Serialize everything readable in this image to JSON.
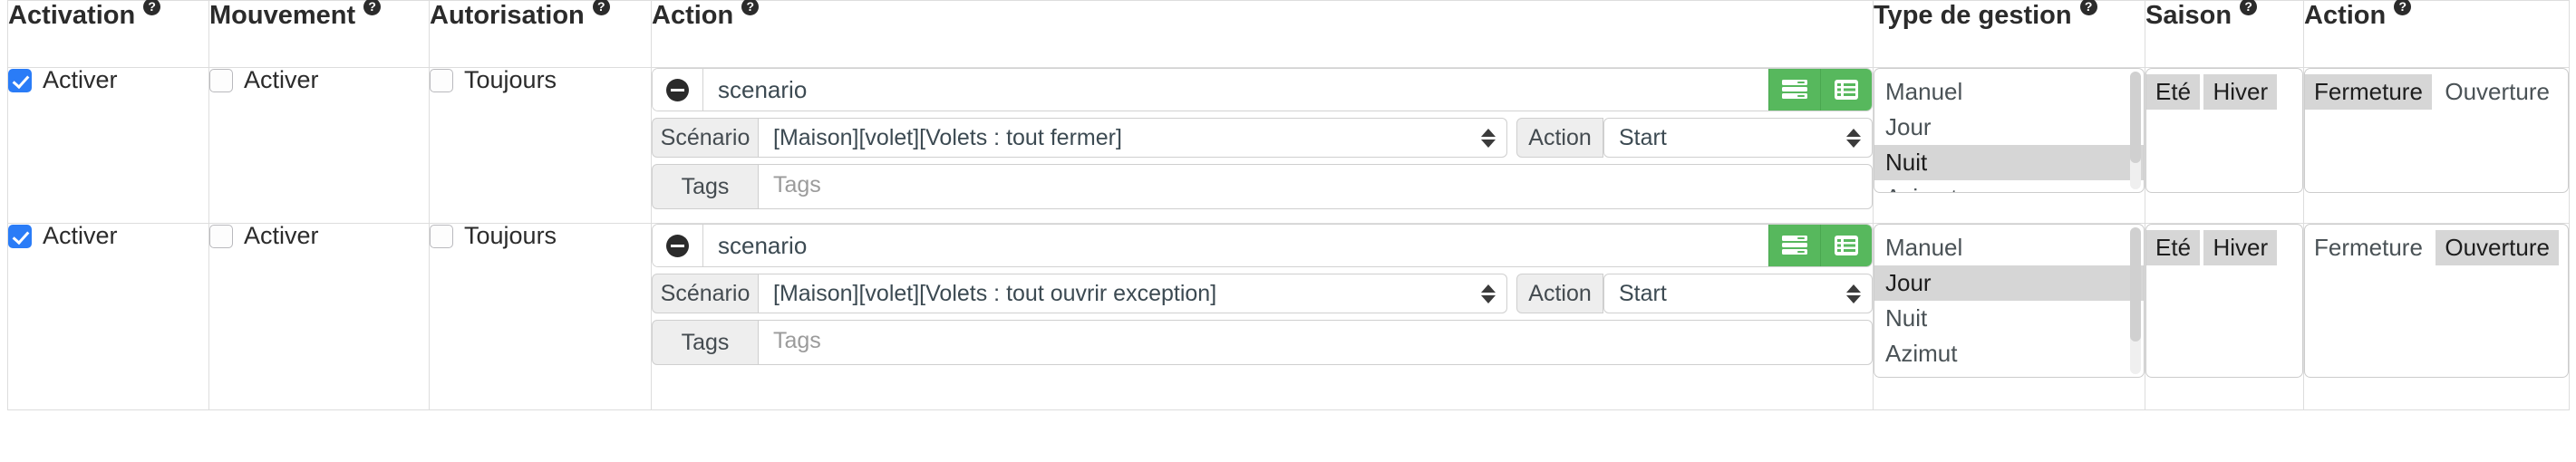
{
  "table": {
    "headers": [
      {
        "label": "Activation",
        "help": "?"
      },
      {
        "label": "Mouvement",
        "help": "?"
      },
      {
        "label": "Autorisation",
        "help": "?"
      },
      {
        "label": "Action",
        "help": "?"
      },
      {
        "label": "Type de gestion",
        "help": "?"
      },
      {
        "label": "Saison",
        "help": "?"
      },
      {
        "label": "Action",
        "help": "?"
      }
    ],
    "rows": [
      {
        "activation": {
          "label": "Activer",
          "checked": true
        },
        "mouvement": {
          "label": "Activer",
          "checked": false
        },
        "autorisation": {
          "label": "Toujours",
          "checked": false
        },
        "action": {
          "name": "scenario",
          "minus_icon": "minus-circle-icon",
          "buttons": [
            {
              "icon": "sliders-icon"
            },
            {
              "icon": "list-table-icon"
            }
          ],
          "scenario_label": "Scénario",
          "scenario_value": "[Maison][volet][Volets : tout fermer]",
          "action_label": "Action",
          "action_value": "Start",
          "tags_label": "Tags",
          "tags_value": "",
          "tags_placeholder": "Tags"
        },
        "type_de_gestion": {
          "options": [
            "Manuel",
            "Jour",
            "Nuit",
            "Azimut"
          ],
          "selected": [
            "Nuit"
          ]
        },
        "saison": {
          "options": [
            "Eté",
            "Hiver"
          ],
          "selected": [
            "Eté",
            "Hiver"
          ]
        },
        "action_list": {
          "options": [
            "Fermeture",
            "Ouverture"
          ],
          "selected": [
            "Fermeture"
          ]
        }
      },
      {
        "activation": {
          "label": "Activer",
          "checked": true
        },
        "mouvement": {
          "label": "Activer",
          "checked": false
        },
        "autorisation": {
          "label": "Toujours",
          "checked": false
        },
        "action": {
          "name": "scenario",
          "minus_icon": "minus-circle-icon",
          "buttons": [
            {
              "icon": "sliders-icon"
            },
            {
              "icon": "list-table-icon"
            }
          ],
          "scenario_label": "Scénario",
          "scenario_value": "[Maison][volet][Volets : tout ouvrir exception]",
          "action_label": "Action",
          "action_value": "Start",
          "tags_label": "Tags",
          "tags_value": "",
          "tags_placeholder": "Tags"
        },
        "type_de_gestion": {
          "options": [
            "Manuel",
            "Jour",
            "Nuit",
            "Azimut"
          ],
          "selected": [
            "Jour"
          ]
        },
        "saison": {
          "options": [
            "Eté",
            "Hiver"
          ],
          "selected": [
            "Eté",
            "Hiver"
          ]
        },
        "action_list": {
          "options": [
            "Fermeture",
            "Ouverture"
          ],
          "selected": [
            "Ouverture"
          ]
        }
      }
    ]
  },
  "colors": {
    "accent_green": "#57b85d",
    "checkbox_blue": "#2a7cf7",
    "option_selected_bg": "#d6d6d6",
    "border": "#dddddd",
    "addon_bg": "#eeeeee"
  }
}
